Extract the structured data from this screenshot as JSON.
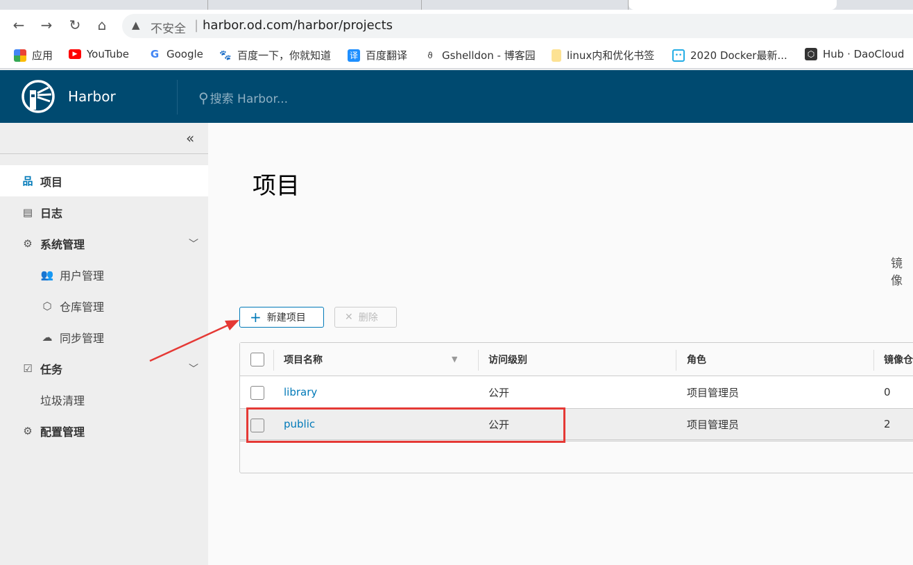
{
  "browser": {
    "address": {
      "security_label": "不安全",
      "url": "harbor.od.com/harbor/projects"
    },
    "bookmarks": [
      {
        "label": "应用",
        "icon": "apps-grid-icon"
      },
      {
        "label": "YouTube",
        "icon": "youtube-icon"
      },
      {
        "label": "Google",
        "icon": "google-icon"
      },
      {
        "label": "百度一下，你就知道",
        "icon": "baidu-icon"
      },
      {
        "label": "百度翻译",
        "icon": "baidu-translate-icon"
      },
      {
        "label": "Gshelldon - 博客园",
        "icon": "cnblogs-icon"
      },
      {
        "label": "linux内和优化书签",
        "icon": "folder-icon"
      },
      {
        "label": "2020 Docker最新...",
        "icon": "bilibili-icon"
      },
      {
        "label": "Hub · DaoCloud",
        "icon": "daocloud-icon"
      }
    ]
  },
  "header": {
    "brand": "Harbor",
    "search_placeholder": "搜索 Harbor...",
    "color": "#004a70"
  },
  "sidebar": {
    "items": [
      {
        "label": "项目",
        "icon": "projects-icon",
        "active": true
      },
      {
        "label": "日志",
        "icon": "logs-icon"
      },
      {
        "label": "系统管理",
        "icon": "admin-icon",
        "expanded": true
      },
      {
        "label": "用户管理",
        "icon": "users-icon"
      },
      {
        "label": "仓库管理",
        "icon": "registry-icon"
      },
      {
        "label": "同步管理",
        "icon": "replication-icon"
      },
      {
        "label": "任务",
        "icon": "tasks-icon",
        "expanded": true
      },
      {
        "label": "垃圾清理"
      },
      {
        "label": "配置管理",
        "icon": "gear-icon"
      }
    ]
  },
  "main": {
    "title": "项目",
    "right_label": "镜像",
    "new_project_label": "新建项目",
    "delete_label": "删除",
    "table": {
      "columns": [
        "项目名称",
        "访问级别",
        "角色",
        "镜像仓"
      ],
      "rows": [
        {
          "name": "library",
          "access": "公开",
          "role": "项目管理员",
          "repos": "0"
        },
        {
          "name": "public",
          "access": "公开",
          "role": "项目管理员",
          "repos": "2",
          "highlighted": true
        }
      ]
    }
  },
  "annotation_color": "#e53935"
}
